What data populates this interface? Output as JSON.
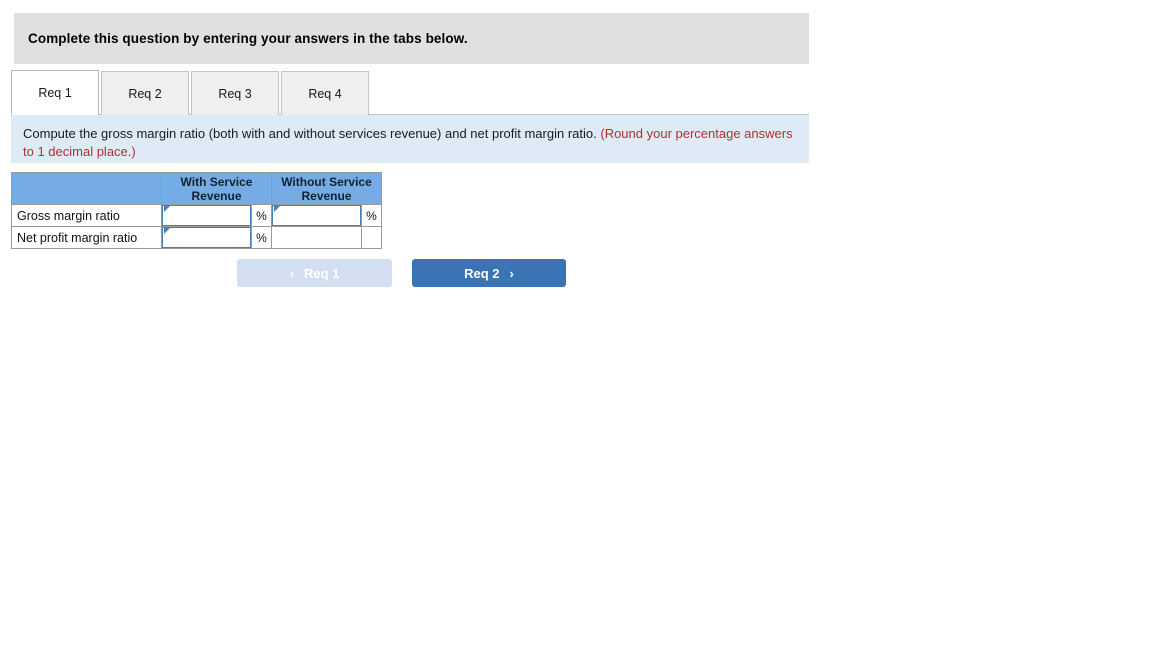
{
  "banner": {
    "text": "Complete this question by entering your answers in the tabs below."
  },
  "tabs": [
    {
      "label": "Req 1",
      "active": true
    },
    {
      "label": "Req 2",
      "active": false
    },
    {
      "label": "Req 3",
      "active": false
    },
    {
      "label": "Req 4",
      "active": false
    }
  ],
  "question": {
    "main_text": "Compute the gross margin ratio (both with and without services revenue) and net profit margin ratio.",
    "note_text": "(Round your percentage answers to 1 decimal place.)"
  },
  "table": {
    "headers": {
      "corner": "",
      "col1": "With Service Revenue",
      "col2": "Without Service Revenue"
    },
    "percent_symbol": "%",
    "rows": [
      {
        "label": "Gross margin ratio",
        "with_service": {
          "value": "",
          "has_input": true,
          "has_percent": true
        },
        "without_service": {
          "value": "",
          "has_input": true,
          "has_percent": true
        }
      },
      {
        "label": "Net profit margin ratio",
        "with_service": {
          "value": "",
          "has_input": true,
          "has_percent": true
        },
        "without_service": {
          "value": "",
          "has_input": false,
          "has_percent": false
        }
      }
    ]
  },
  "navigation": {
    "prev_label": "Req 1",
    "prev_chevron": "‹",
    "prev_disabled": true,
    "next_label": "Req 2",
    "next_chevron": "›"
  },
  "colors": {
    "banner_gray": "#e0e0e0",
    "panel_blue": "#deebf7",
    "table_header_blue": "#76ace5",
    "note_red": "#b03030",
    "next_button_blue": "#3a74b5",
    "prev_button_blue": "#d3dff0",
    "input_border_blue": "#4a7fbd"
  }
}
